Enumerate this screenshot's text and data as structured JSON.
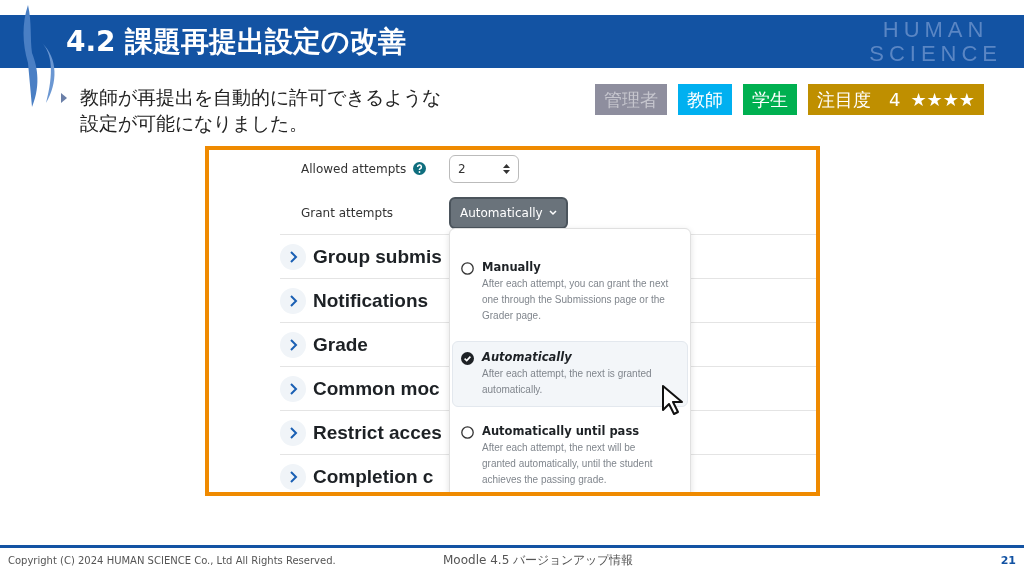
{
  "header": {
    "title": "4.2 課題再提出設定の改善",
    "brand": [
      "HUMAN",
      "SCIENCE"
    ]
  },
  "bullet": "教師が再提出を自動的に許可できるような設定が可能になりました。",
  "tags": [
    {
      "label": "管理者",
      "selected": false,
      "color": "#8e8e9e"
    },
    {
      "label": "教師",
      "selected": true,
      "color": "#00b0f0"
    },
    {
      "label": "学生",
      "selected": true,
      "color": "#00b050"
    },
    {
      "label": "注目度　4",
      "selected": true,
      "color": "#bf8f00",
      "stars": 4
    }
  ],
  "screenshot": {
    "fields": [
      {
        "label": "Allowed attempts",
        "kind": "select",
        "value": "2",
        "help": true
      },
      {
        "label": "Grant attempts",
        "kind": "button",
        "value": "Automatically",
        "help": false
      }
    ],
    "sections": [
      "Group submis",
      "Notifications",
      "Grade",
      "Common moc",
      "Restrict acces",
      "Completion c"
    ],
    "menu": [
      {
        "title": "Manually",
        "description": "After each attempt, you can grant the next one through the Submissions page or the Grader page.",
        "selected": false
      },
      {
        "title": "Automatically",
        "description": "After each attempt, the next is granted automatically.",
        "selected": true
      },
      {
        "title": "Automatically until pass",
        "description": "After each attempt, the next will be granted automatically, until the student achieves the passing grade.",
        "selected": false
      }
    ]
  },
  "footer": {
    "copyright": "Copyright (C) 2024 HUMAN SCIENCE Co., Ltd All Rights Reserved.",
    "center": "Moodle 4.5 バージョンアップ情報",
    "page": "21"
  }
}
